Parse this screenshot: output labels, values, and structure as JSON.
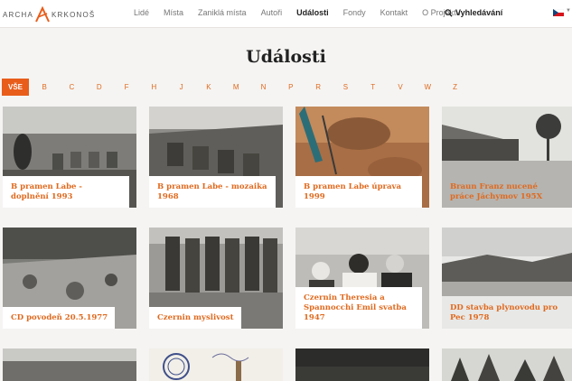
{
  "brand": {
    "left": "ARCHA",
    "right": "KRKONOŠ",
    "accent": "#e85d1a"
  },
  "nav": [
    {
      "label": "Lidé",
      "active": false
    },
    {
      "label": "Místa",
      "active": false
    },
    {
      "label": "Zaniklá místa",
      "active": false
    },
    {
      "label": "Autoři",
      "active": false
    },
    {
      "label": "Události",
      "active": true
    },
    {
      "label": "Fondy",
      "active": false
    },
    {
      "label": "Kontakt",
      "active": false
    },
    {
      "label": "O Projektu",
      "active": false
    }
  ],
  "search": {
    "label": "Vyhledávání",
    "icon": "search-icon"
  },
  "language": {
    "icon": "czech-flag-icon"
  },
  "page_title": "Události",
  "letters": [
    "VŠE",
    "B",
    "C",
    "D",
    "F",
    "H",
    "J",
    "K",
    "M",
    "N",
    "P",
    "R",
    "S",
    "T",
    "V",
    "W",
    "Z"
  ],
  "cards": [
    {
      "caption": "B pramen Labe - doplnění 1993",
      "photo": "bw-workers-shields"
    },
    {
      "caption": "B pramen Labe - mozaika 1968",
      "photo": "bw-shields-wall"
    },
    {
      "caption": "B pramen Labe úprava 1999",
      "photo": "color-soil-digging"
    },
    {
      "caption": "Braun Franz nucené práce Jáchymov 195X",
      "photo": "bw-barracks"
    },
    {
      "caption": "CD povodeň 20.5.1977",
      "photo": "bw-flood-rocks"
    },
    {
      "caption": "Czernin myslivost",
      "photo": "bw-hunters-group"
    },
    {
      "caption": "Czernin Theresia a Spannocchi Emil svatba 1947",
      "photo": "bw-wedding"
    },
    {
      "caption": "DD stavba plynovodu pro Pec 1978",
      "photo": "bw-pipeline-landscape"
    },
    {
      "caption": "",
      "photo": "bw-river"
    },
    {
      "caption": "",
      "photo": "stamp-document"
    },
    {
      "caption": "",
      "photo": "dark-photo"
    },
    {
      "caption": "",
      "photo": "bw-forest"
    }
  ]
}
